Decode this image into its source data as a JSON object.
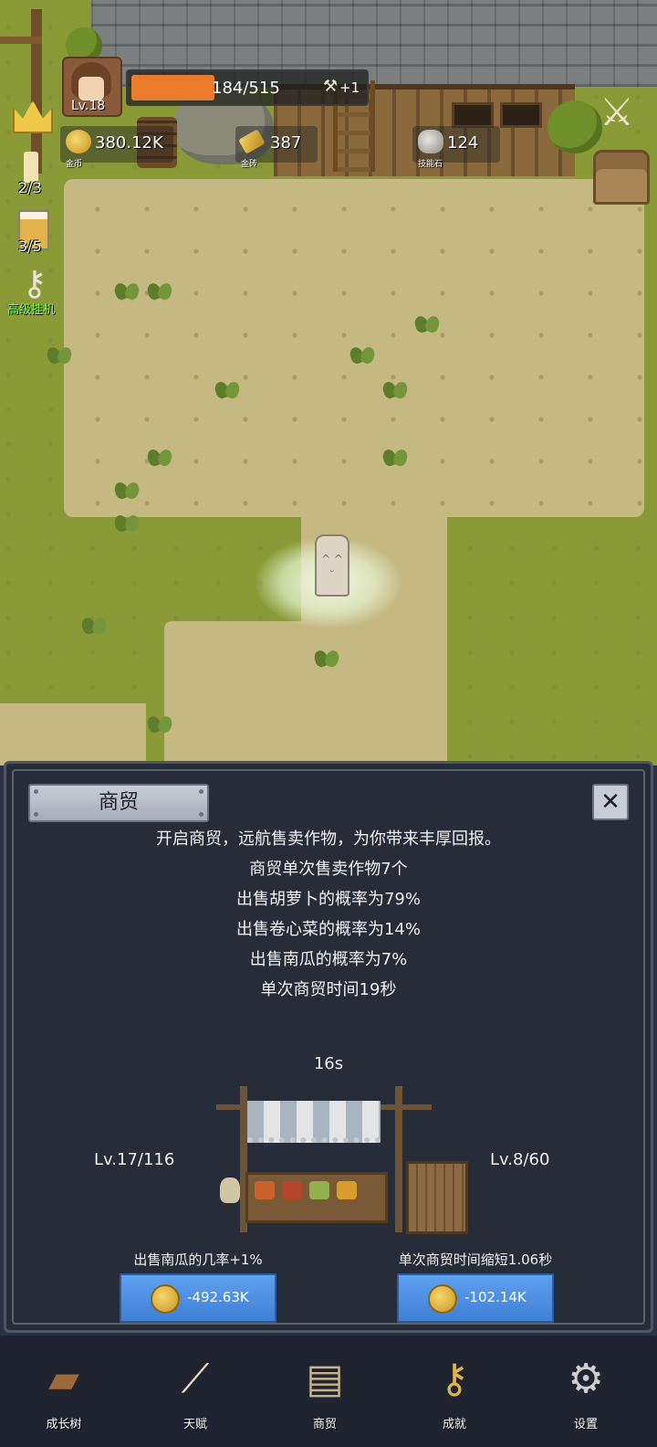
{
  "hud": {
    "level": "Lv.18",
    "xp_text": "184/515",
    "xp_fraction": 0.357,
    "xp_bonus": "+1",
    "gold": {
      "value": "380.12K",
      "label": "金币"
    },
    "gold_bar": {
      "value": "387",
      "label": "金砖"
    },
    "skill_stone": {
      "value": "124",
      "label": "技能石"
    },
    "side": {
      "candle_count": "2/3",
      "beer_count": "3/5",
      "idle_label": "高级挂机"
    }
  },
  "panel": {
    "title": "商贸",
    "close_glyph": "✕",
    "description": [
      "开启商贸，远航售卖作物，为你带来丰厚回报。",
      "商贸单次售卖作物7个",
      "出售胡萝卜的概率为79%",
      "出售卷心菜的概率为14%",
      "出售南瓜的概率为7%",
      "单次商贸时间19秒"
    ],
    "timer": "16s",
    "left_upgrade": {
      "level": "Lv.17/116",
      "desc": "出售南瓜的几率+1%",
      "cost": "-492.63K"
    },
    "right_upgrade": {
      "level": "Lv.8/60",
      "desc": "单次商贸时间缩短1.06秒",
      "cost": "-102.14K"
    }
  },
  "nav": [
    {
      "label": "成长树",
      "icon": "book-icon"
    },
    {
      "label": "天赋",
      "icon": "scroll-icon"
    },
    {
      "label": "商贸",
      "icon": "map-icon"
    },
    {
      "label": "成就",
      "icon": "key-icon"
    },
    {
      "label": "设置",
      "icon": "gear-icon"
    }
  ],
  "colors": {
    "xp_fill": "#ea7b2a",
    "button_blue": "#4a8ee3",
    "panel_bg": "#262c38",
    "idle_label": "#7dff5a"
  }
}
